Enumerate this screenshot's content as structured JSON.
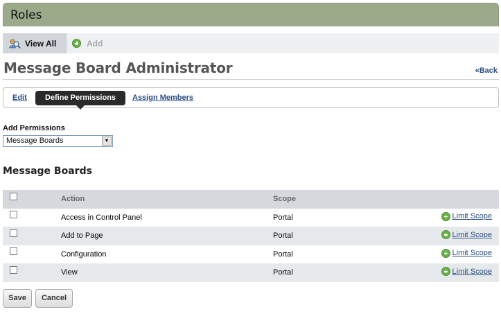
{
  "portlet": {
    "title": "Roles"
  },
  "nav": {
    "view_all": {
      "label": "View All",
      "icon": "roles-view-icon"
    },
    "add": {
      "label": "Add",
      "icon": "add-circle-icon"
    }
  },
  "page": {
    "heading": "Message Board Administrator",
    "back_label": "«Back"
  },
  "tabs": [
    {
      "label": "Edit",
      "active": false
    },
    {
      "label": "Define Permissions",
      "active": true
    },
    {
      "label": "Assign Members",
      "active": false
    }
  ],
  "add_permissions": {
    "label": "Add Permissions",
    "selected": "Message Boards"
  },
  "section": {
    "title": "Message Boards"
  },
  "table": {
    "headers": {
      "action": "Action",
      "scope": "Scope"
    },
    "rows": [
      {
        "action": "Access in Control Panel",
        "scope": "Portal",
        "limit": "Limit Scope",
        "checked": false
      },
      {
        "action": "Add to Page",
        "scope": "Portal",
        "limit": "Limit Scope",
        "checked": false
      },
      {
        "action": "Configuration",
        "scope": "Portal",
        "limit": "Limit Scope",
        "checked": false
      },
      {
        "action": "View",
        "scope": "Portal",
        "limit": "Limit Scope",
        "checked": false
      }
    ]
  },
  "buttons": {
    "save": "Save",
    "cancel": "Cancel"
  },
  "colors": {
    "title_bar": "#9aaa8a",
    "link": "#2a4d80",
    "active_tab": "#2a2a2a",
    "plus_green": "#6cb04a"
  }
}
